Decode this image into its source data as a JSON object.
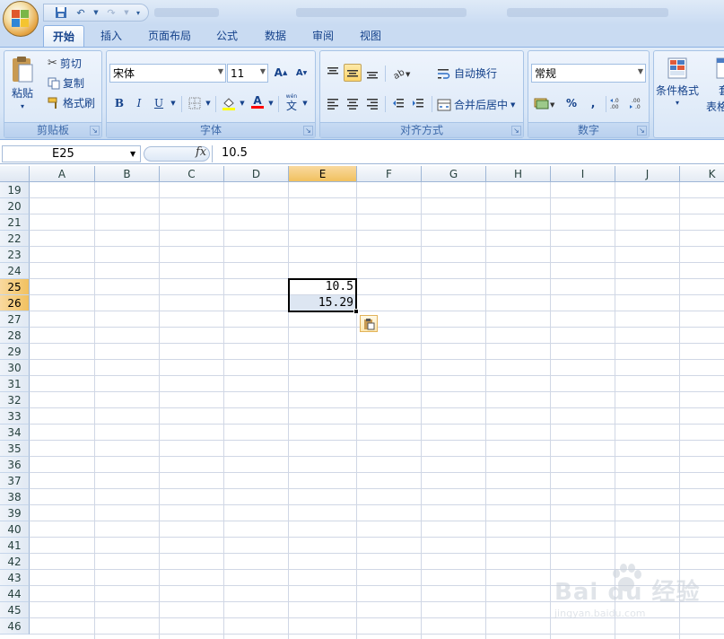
{
  "quick_access": {
    "undo_label": "↶",
    "redo_label": "↷"
  },
  "tabs": [
    "开始",
    "插入",
    "页面布局",
    "公式",
    "数据",
    "审阅",
    "视图"
  ],
  "active_tab": "开始",
  "clipboard": {
    "paste": "粘贴",
    "cut": "剪切",
    "copy": "复制",
    "format_painter": "格式刷",
    "group": "剪贴板"
  },
  "font": {
    "name": "宋体",
    "size": "11",
    "bold": "B",
    "italic": "I",
    "underline": "U",
    "font_color_letter": "A",
    "phonetic": "文",
    "group": "字体"
  },
  "alignment": {
    "wrap_text": "自动换行",
    "merge_center": "合并后居中",
    "group": "对齐方式"
  },
  "number": {
    "format": "常规",
    "percent": "%",
    "comma": ",",
    "group": "数字"
  },
  "styles": {
    "conditional_format": "条件格式",
    "partial_1": "套",
    "partial_2": "表格"
  },
  "formula_bar": {
    "name_box": "E25",
    "fx": "fx",
    "value": "10.5"
  },
  "columns": [
    "A",
    "B",
    "C",
    "D",
    "E",
    "F",
    "G",
    "H",
    "I",
    "J",
    "K"
  ],
  "rows": [
    "19",
    "20",
    "21",
    "22",
    "23",
    "24",
    "25",
    "26",
    "27",
    "28",
    "29",
    "30",
    "31",
    "32",
    "33",
    "34",
    "35",
    "36",
    "37",
    "38",
    "39",
    "40",
    "41",
    "42",
    "43",
    "44",
    "45",
    "46"
  ],
  "selected_column": "E",
  "selected_rows": [
    "25",
    "26"
  ],
  "cells": [
    {
      "ref": "E25",
      "value": "10.5"
    },
    {
      "ref": "E26",
      "value": "15.29"
    }
  ],
  "watermark": {
    "brand": "Bai du 经验",
    "url": "jingyan.baidu.com"
  },
  "colors": {
    "accent": "#15428b",
    "selection_header": "#f1c15f",
    "ribbon": "#dae7f7"
  }
}
